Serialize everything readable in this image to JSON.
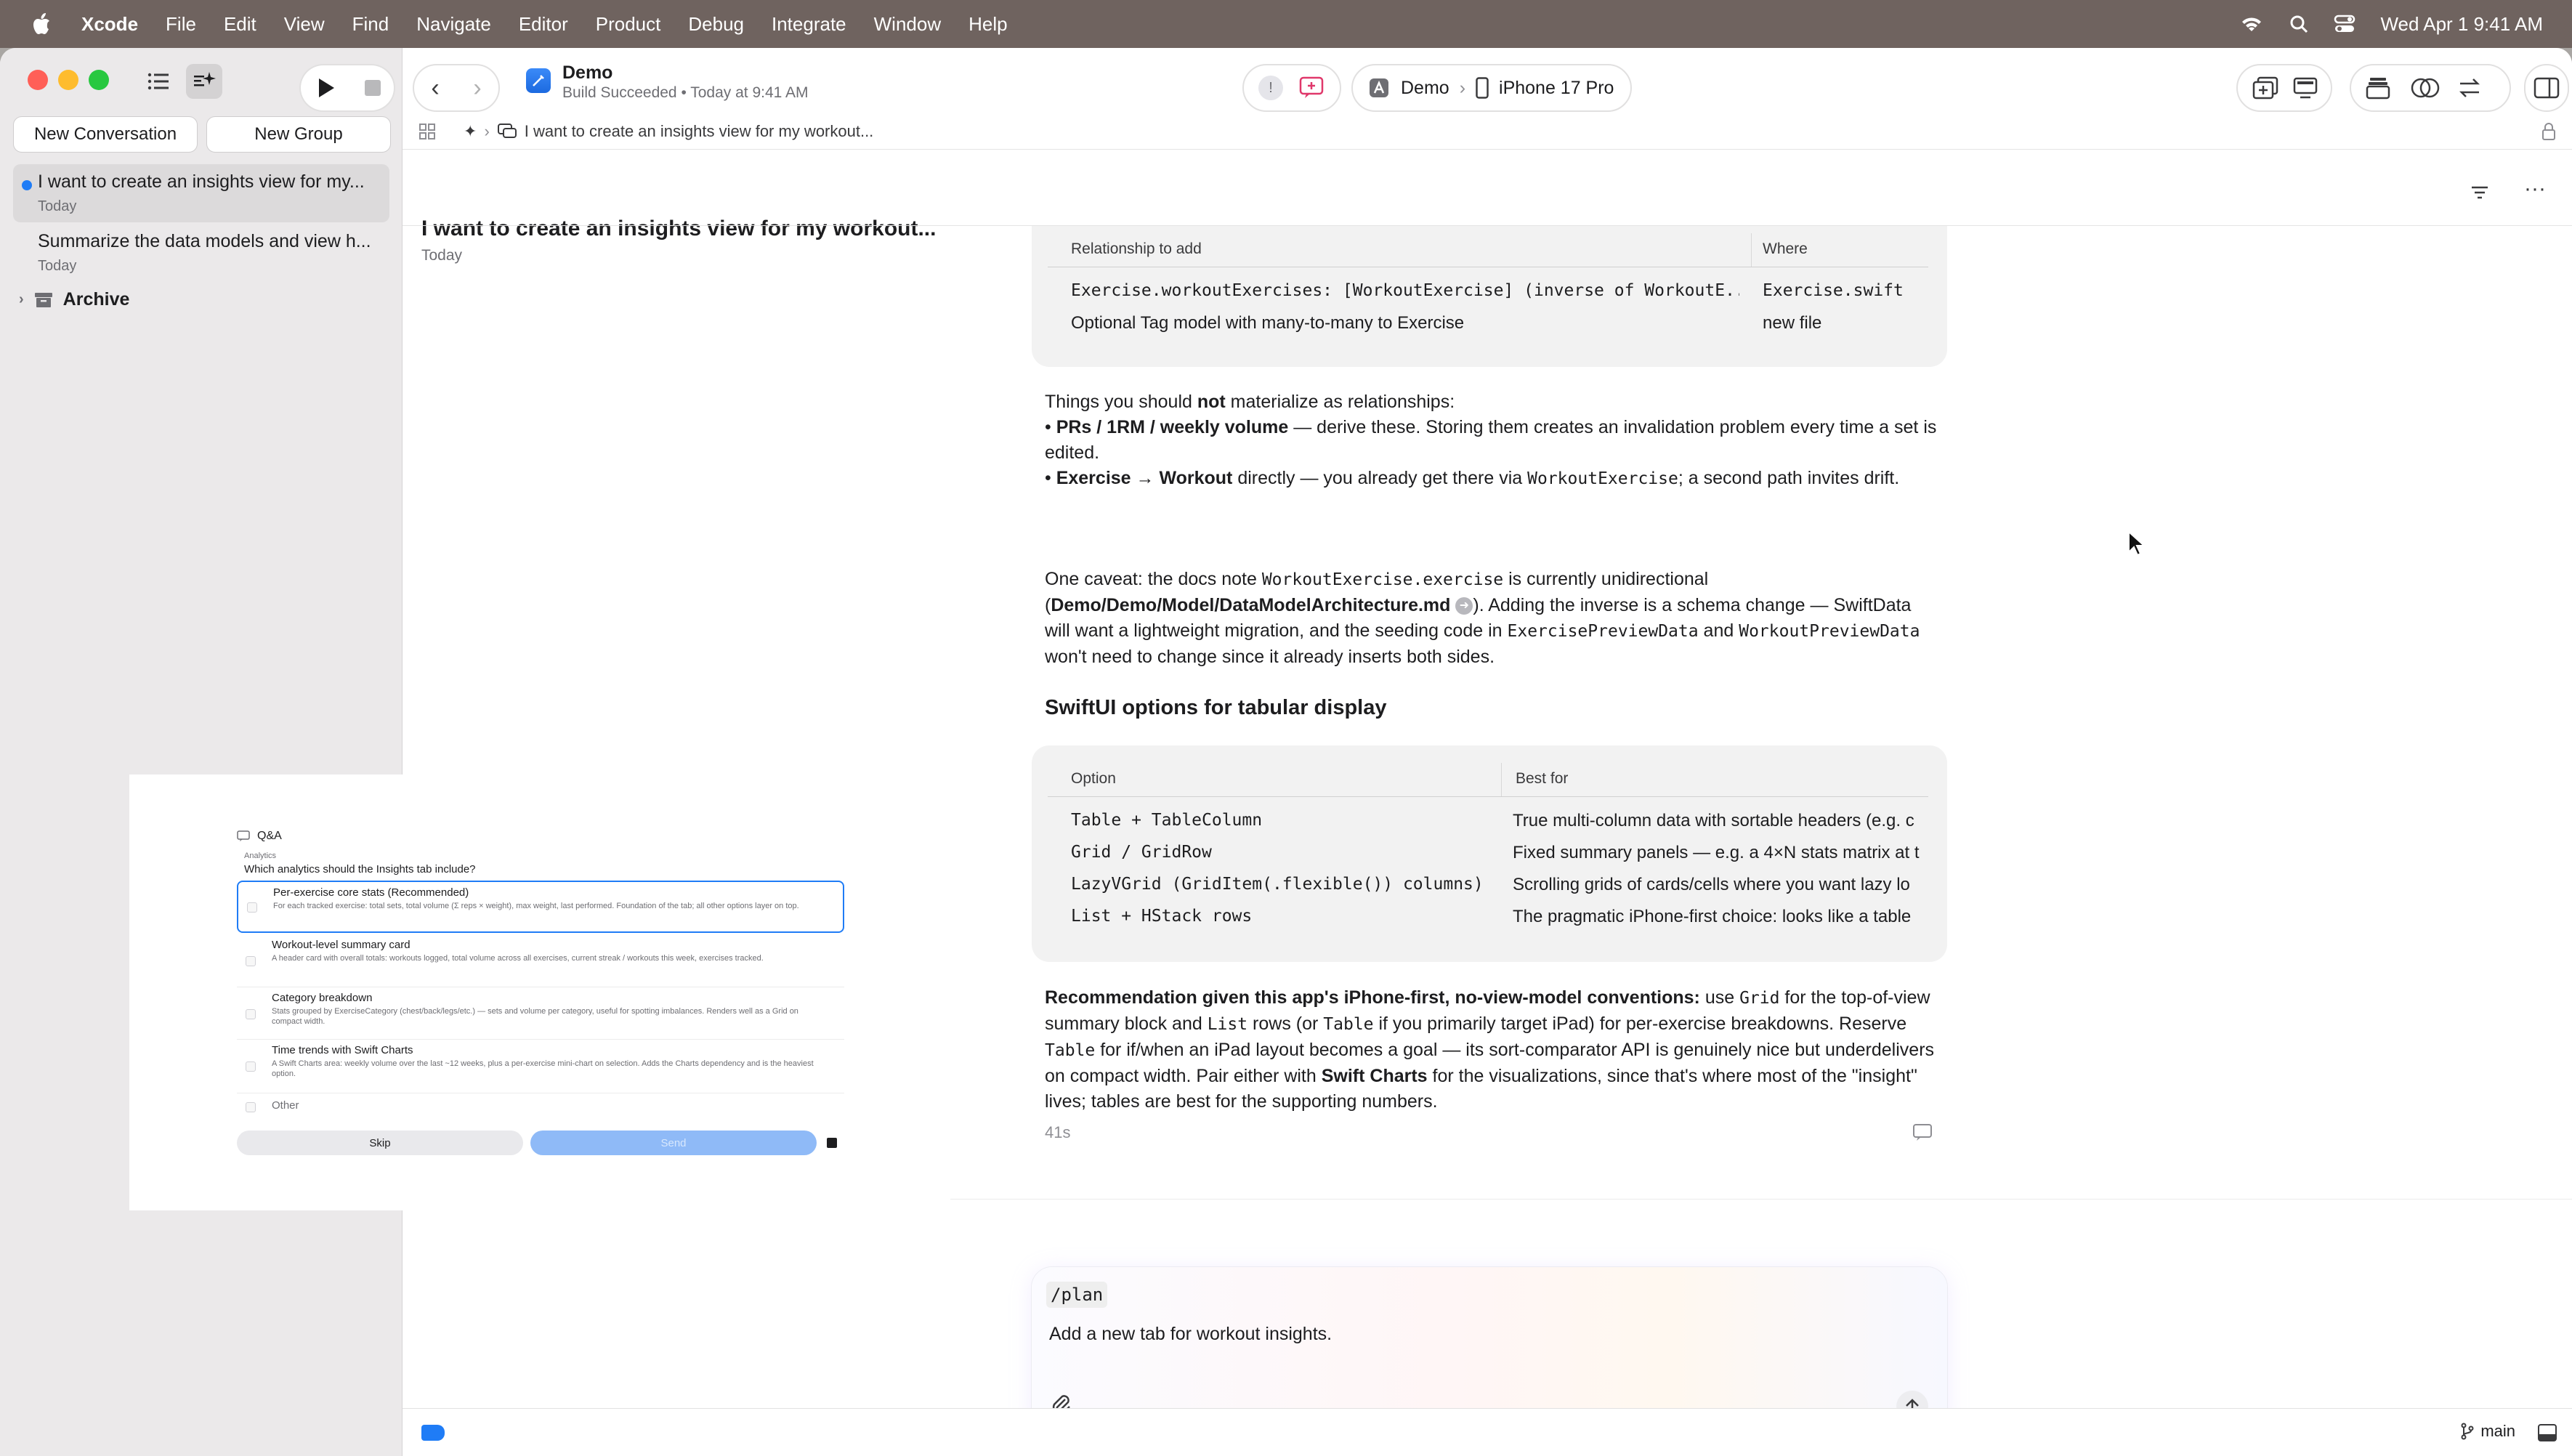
{
  "menubar": {
    "app": "Xcode",
    "items": [
      "File",
      "Edit",
      "View",
      "Find",
      "Navigate",
      "Editor",
      "Product",
      "Debug",
      "Integrate",
      "Window",
      "Help"
    ],
    "clock": "Wed Apr 1  9:41 AM"
  },
  "toolbar": {
    "project_name": "Demo",
    "build_status": "Build Succeeded • Today at 9:41 AM",
    "scheme": "Demo",
    "destination": "iPhone 17 Pro"
  },
  "sidebar": {
    "new_conversation": "New Conversation",
    "new_group": "New Group",
    "conversations": [
      {
        "title": "I want to create an insights view for my...",
        "date": "Today"
      },
      {
        "title": "Summarize the data models and view h...",
        "date": "Today"
      }
    ],
    "archive": "Archive"
  },
  "jumpbar": {
    "title": "I want to create an insights view for my workout..."
  },
  "header": {
    "title": "I want to create an insights view for my workout...",
    "date": "Today"
  },
  "rel_table": {
    "col1": "Relationship to add",
    "col2": "Where",
    "rows": [
      {
        "a": "Exercise.workoutExercises: [WorkoutExercise] (inverse of WorkoutE...",
        "b": "Exercise.swift"
      },
      {
        "a": "Optional Tag model with many-to-many to Exercise",
        "b": "new file"
      }
    ]
  },
  "para1": {
    "intro_pre": "Things you should ",
    "intro_bold": "not",
    "intro_post": " materialize as relationships:",
    "b1_bold": "PRs / 1RM / weekly volume",
    "b1_text": " — derive these. Storing them creates an invalidation problem every time a set is edited.",
    "b2_bold": "Exercise → Workout",
    "b2_text": " directly — you already get there via ",
    "b2_code": "WorkoutExercise",
    "b2_tail": "; a second path invites drift."
  },
  "para2": {
    "t1": "One caveat: the docs note ",
    "c1": "WorkoutExercise.exercise",
    "t2": " is currently unidirectional (",
    "link": "Demo/Demo/Model/DataModelArchitecture.md",
    "t3": "). Adding the inverse is a schema change — SwiftData will want a lightweight migration, and the seeding code in ",
    "c2": "ExercisePreviewData",
    "t4": " and ",
    "c3": "WorkoutPreviewData",
    "t5": " won't need to change since it already inserts both sides."
  },
  "section_heading": "SwiftUI options for tabular display",
  "options_table": {
    "col1": "Option",
    "col2": "Best for",
    "rows": [
      {
        "a": "Table + TableColumn",
        "b": "True multi-column data with sortable headers (e.g. c"
      },
      {
        "a": "Grid / GridRow",
        "b": "Fixed summary panels — e.g. a 4×N stats matrix at t"
      },
      {
        "a": "LazyVGrid (GridItem(.flexible()) columns)",
        "b": "Scrolling grids of cards/cells where you want lazy lo"
      },
      {
        "a": "List + HStack rows",
        "b": "The pragmatic iPhone-first choice: looks like a table"
      }
    ]
  },
  "recommendation": {
    "bold1": "Recommendation given this app's iPhone-first, no-view-model conventions:",
    "t1": " use ",
    "c1": "Grid",
    "t2": " for the top-of-view summary block and ",
    "c2": "List",
    "t3": " rows (or ",
    "c3": "Table",
    "t4": " if you primarily target iPad) for per-exercise breakdowns. Reserve ",
    "c4": "Table",
    "t5": " for if/when an iPad layout becomes a goal — its sort-comparator API is genuinely nice but underdelivers on compact width. Pair either with ",
    "bold2": "Swift Charts",
    "t6": " for the visualizations, since that's where most of the \"insight\" lives; tables are best for the supporting numbers."
  },
  "elapsed": "41s",
  "composer": {
    "command": "/plan",
    "text": "Add a new tab for workout insights."
  },
  "qa": {
    "header": "Q&A",
    "category": "Analytics",
    "question": "Which analytics should the Insights tab include?",
    "options": [
      {
        "title": "Per-exercise core stats (Recommended)",
        "desc": "For each tracked exercise: total sets, total volume (Σ reps × weight), max weight, last performed. Foundation of the tab; all other options layer on top."
      },
      {
        "title": "Workout-level summary card",
        "desc": "A header card with overall totals: workouts logged, total volume across all exercises, current streak / workouts this week, exercises tracked."
      },
      {
        "title": "Category breakdown",
        "desc": "Stats grouped by ExerciseCategory (chest/back/legs/etc.) — sets and volume per category, useful for spotting imbalances. Renders well as a Grid on compact width."
      },
      {
        "title": "Time trends with Swift Charts",
        "desc": "A Swift Charts area: weekly volume over the last ~12 weeks, plus a per-exercise mini-chart on selection. Adds the Charts dependency and is the heaviest option."
      }
    ],
    "other": "Other",
    "skip": "Skip",
    "send": "Send"
  },
  "statusbar": {
    "branch": "main"
  },
  "colors": {
    "accent": "#1f7cf6",
    "menubar": "#6f635f"
  }
}
